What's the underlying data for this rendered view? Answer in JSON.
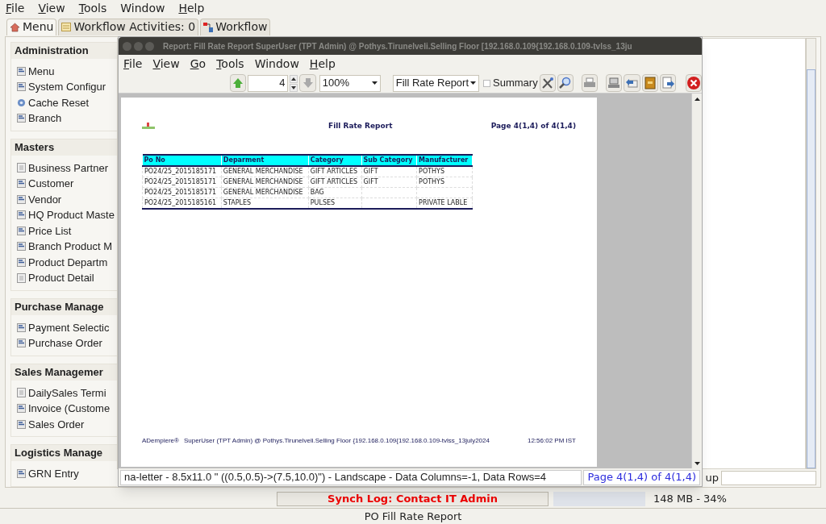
{
  "menubar": [
    {
      "label": "File",
      "underlined": true
    },
    {
      "label": "View",
      "underlined": true
    },
    {
      "label": "Tools",
      "underlined": true
    },
    {
      "label": "Window",
      "underlined": false
    },
    {
      "label": "Help",
      "underlined": true
    }
  ],
  "tabs": [
    {
      "label": "Menu",
      "selected": true
    },
    {
      "label": "Workflow Activities: 0",
      "selected": false
    },
    {
      "label": "Workflow",
      "selected": false
    }
  ],
  "sidebar": [
    {
      "title": "Administration",
      "items": [
        {
          "label": "Menu",
          "kind": "window"
        },
        {
          "label": "System Configur",
          "kind": "window"
        },
        {
          "label": "Cache Reset",
          "kind": "process"
        },
        {
          "label": "Branch",
          "kind": "window"
        }
      ]
    },
    {
      "title": "Masters",
      "items": [
        {
          "label": "Business Partner",
          "kind": "form"
        },
        {
          "label": "Customer",
          "kind": "window"
        },
        {
          "label": "Vendor",
          "kind": "window"
        },
        {
          "label": "HQ Product Maste",
          "kind": "window"
        },
        {
          "label": "Price List",
          "kind": "window"
        },
        {
          "label": "Branch Product M",
          "kind": "window"
        },
        {
          "label": "Product Departm",
          "kind": "window"
        },
        {
          "label": "Product Detail",
          "kind": "form"
        }
      ]
    },
    {
      "title": "Purchase Manage",
      "items": [
        {
          "label": "Payment Selectic",
          "kind": "window"
        },
        {
          "label": "Purchase Order",
          "kind": "window"
        }
      ]
    },
    {
      "title": "Sales Managemer",
      "items": [
        {
          "label": "DailySales Termi",
          "kind": "form"
        },
        {
          "label": "Invoice (Custome",
          "kind": "window"
        },
        {
          "label": "Sales Order",
          "kind": "window"
        }
      ]
    },
    {
      "title": "Logistics Manage",
      "items": [
        {
          "label": "GRN Entry",
          "kind": "window"
        }
      ]
    }
  ],
  "lookup_label": "up",
  "report_window": {
    "title": "Report: Fill Rate Report  SuperUser (TPT Admin) @ Pothys.Tirunelveli.Selling Floor [192.168.0.109{192.168.0.109-tvlss_13ju",
    "menubar": [
      {
        "label": "File",
        "underlined": true
      },
      {
        "label": "View",
        "underlined": true
      },
      {
        "label": "Go",
        "underlined": true
      },
      {
        "label": "Tools",
        "underlined": true
      },
      {
        "label": "Window",
        "underlined": false
      },
      {
        "label": "Help",
        "underlined": true
      }
    ],
    "toolbar": {
      "page": "4",
      "zoom": "100%",
      "report": "Fill Rate Report",
      "summary": {
        "label": "Summary",
        "checked": false
      },
      "next_disabled": true
    },
    "page": {
      "title": "Fill Rate Report",
      "page_info": "Page 4(1,4) of 4(1,4)",
      "table": {
        "columns": [
          "Po No",
          "Deparment",
          "Category",
          "Sub Category",
          "Manufacturer"
        ],
        "rows": [
          [
            "PO24/25_2015185171",
            "GENERAL MERCHANDISE",
            "GIFT ARTICLES",
            "GIFT",
            "POTHYS"
          ],
          [
            "PO24/25_2015185171",
            "GENERAL MERCHANDISE",
            "GIFT ARTICLES",
            "GIFT",
            "POTHYS"
          ],
          [
            "PO24/25_2015185171",
            "GENERAL MERCHANDISE",
            "BAG",
            "",
            ""
          ],
          [
            "PO24/25_2015185161",
            "STAPLES",
            "PULSES",
            "",
            "PRIVATE LABLE"
          ]
        ]
      },
      "footer": [
        "ADempiere®",
        "SuperUser (TPT Admin) @ Pothys.Tirunelveli.Selling Floor {192.168.0.109{192.168.0.109-tvlss_13july2024",
        "12:56:02 PM IST"
      ]
    },
    "status": "na-letter - 8.5x11.0 \" ((0.5,0.5)->(7.5,10.0)\") - Landscape - Data Columns=-1, Data Rows=4",
    "status_page": "Page 4(1,4) of 4(1,4)"
  },
  "synch_log": "Synch Log: Contact IT Admin",
  "memory": "148 MB - 34%",
  "footer": "PO Fill Rate Report"
}
